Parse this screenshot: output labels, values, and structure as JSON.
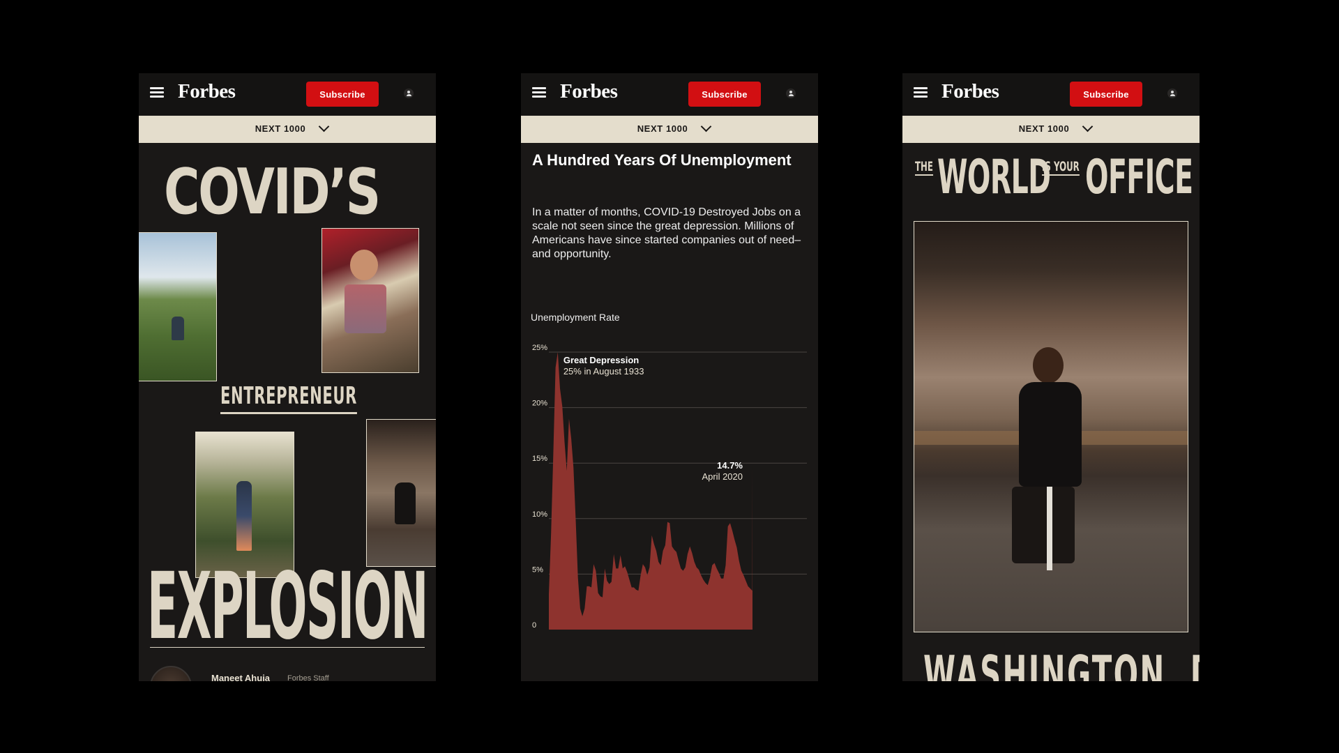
{
  "screens": [
    {
      "header": {
        "logo": "Forbes",
        "subscribe_label": "Subscribe",
        "section_label": "NEXT 1000"
      },
      "title": {
        "line1": "COVID’S",
        "line2": "ENTREPRENEUR",
        "line3": "EXPLOSION"
      },
      "byline": {
        "author": "Maneet Ahuja",
        "role": "Forbes Staff"
      }
    },
    {
      "header": {
        "logo": "Forbes",
        "subscribe_label": "Subscribe",
        "section_label": "NEXT 1000"
      },
      "headline": "A Hundred Years Of Unemployment",
      "dek": "In a matter of months, COVID-19 Destroyed Jobs on a scale not seen since the great depression. Millions of Americans have since started companies out of need–and opportunity."
    },
    {
      "header": {
        "logo": "Forbes",
        "subscribe_label": "Subscribe",
        "section_label": "NEXT 1000"
      },
      "title": {
        "the": "THE",
        "world": "WORLD",
        "is_your": "IS YOUR",
        "office": "OFFICE"
      },
      "city": "WASHINGTON, DC"
    }
  ],
  "chart_data": {
    "type": "area",
    "ylabel": "Unemployment Rate",
    "ylim": [
      0,
      25
    ],
    "y_ticks": [
      "0",
      "5%",
      "10%",
      "15%",
      "20%",
      "25%"
    ],
    "x_range": [
      1929,
      2020
    ],
    "color": "#8e332e",
    "points": [
      [
        1929,
        3.2
      ],
      [
        1930,
        8.7
      ],
      [
        1931,
        15.9
      ],
      [
        1932,
        23.6
      ],
      [
        1933,
        25.0
      ],
      [
        1934,
        21.7
      ],
      [
        1935,
        20.1
      ],
      [
        1936,
        16.9
      ],
      [
        1937,
        14.3
      ],
      [
        1938,
        19.0
      ],
      [
        1939,
        17.2
      ],
      [
        1940,
        14.6
      ],
      [
        1941,
        9.9
      ],
      [
        1942,
        4.7
      ],
      [
        1943,
        1.9
      ],
      [
        1944,
        1.2
      ],
      [
        1945,
        1.9
      ],
      [
        1946,
        3.9
      ],
      [
        1947,
        3.9
      ],
      [
        1948,
        3.8
      ],
      [
        1949,
        5.9
      ],
      [
        1950,
        5.3
      ],
      [
        1951,
        3.3
      ],
      [
        1952,
        3.0
      ],
      [
        1953,
        2.9
      ],
      [
        1954,
        5.5
      ],
      [
        1955,
        4.4
      ],
      [
        1956,
        4.1
      ],
      [
        1957,
        4.3
      ],
      [
        1958,
        6.8
      ],
      [
        1959,
        5.5
      ],
      [
        1960,
        5.5
      ],
      [
        1961,
        6.7
      ],
      [
        1962,
        5.5
      ],
      [
        1963,
        5.7
      ],
      [
        1964,
        5.2
      ],
      [
        1965,
        4.5
      ],
      [
        1966,
        3.8
      ],
      [
        1967,
        3.8
      ],
      [
        1968,
        3.6
      ],
      [
        1969,
        3.5
      ],
      [
        1970,
        4.9
      ],
      [
        1971,
        5.9
      ],
      [
        1972,
        5.6
      ],
      [
        1973,
        4.9
      ],
      [
        1974,
        5.6
      ],
      [
        1975,
        8.5
      ],
      [
        1976,
        7.7
      ],
      [
        1977,
        7.1
      ],
      [
        1978,
        6.1
      ],
      [
        1979,
        5.8
      ],
      [
        1980,
        7.1
      ],
      [
        1981,
        7.6
      ],
      [
        1982,
        9.7
      ],
      [
        1983,
        9.6
      ],
      [
        1984,
        7.5
      ],
      [
        1985,
        7.2
      ],
      [
        1986,
        7.0
      ],
      [
        1987,
        6.2
      ],
      [
        1988,
        5.5
      ],
      [
        1989,
        5.3
      ],
      [
        1990,
        5.6
      ],
      [
        1991,
        6.8
      ],
      [
        1992,
        7.5
      ],
      [
        1993,
        6.9
      ],
      [
        1994,
        6.1
      ],
      [
        1995,
        5.6
      ],
      [
        1996,
        5.4
      ],
      [
        1997,
        4.9
      ],
      [
        1998,
        4.5
      ],
      [
        1999,
        4.2
      ],
      [
        2000,
        4.0
      ],
      [
        2001,
        4.7
      ],
      [
        2002,
        5.8
      ],
      [
        2003,
        6.0
      ],
      [
        2004,
        5.5
      ],
      [
        2005,
        5.1
      ],
      [
        2006,
        4.6
      ],
      [
        2007,
        4.6
      ],
      [
        2008,
        5.8
      ],
      [
        2009,
        9.3
      ],
      [
        2010,
        9.6
      ],
      [
        2011,
        8.9
      ],
      [
        2012,
        8.1
      ],
      [
        2013,
        7.4
      ],
      [
        2014,
        6.2
      ],
      [
        2015,
        5.3
      ],
      [
        2016,
        4.9
      ],
      [
        2017,
        4.4
      ],
      [
        2018,
        3.9
      ],
      [
        2019,
        3.7
      ],
      [
        2019.9,
        3.5
      ],
      [
        2020,
        14.7
      ]
    ],
    "annotations": [
      {
        "title": "Great Depression",
        "text": "25% in August 1933",
        "x": 1933,
        "y": 25
      },
      {
        "title": "14.7%",
        "text": "April 2020",
        "x": 2020,
        "y": 14.7
      }
    ]
  }
}
